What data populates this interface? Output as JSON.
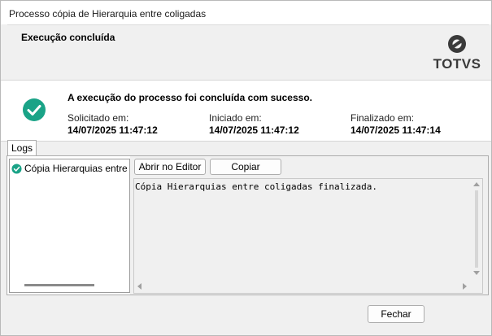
{
  "window": {
    "title": "Processo cópia de Hierarquia entre coligadas"
  },
  "header": {
    "title": "Execução concluída",
    "logo_text": "TOTVS"
  },
  "info": {
    "message": "A execução do processo foi concluída com sucesso.",
    "requested": {
      "label": "Solicitado em:",
      "value": "14/07/2025 11:47:12"
    },
    "started": {
      "label": "Iniciado em:",
      "value": "14/07/2025 11:47:12"
    },
    "finished": {
      "label": "Finalizado em:",
      "value": "14/07/2025 11:47:14"
    }
  },
  "tabs": [
    {
      "label": "Logs"
    }
  ],
  "logs": {
    "items": [
      {
        "label": "Cópia Hierarquias entre coligadas"
      }
    ]
  },
  "editor": {
    "open_button": "Abrir no Editor",
    "copy_button": "Copiar",
    "text": "Cópia Hierarquias entre coligadas finalizada."
  },
  "footer": {
    "close_button": "Fechar"
  },
  "colors": {
    "success": "#1aa387",
    "logo": "#3a3a3a"
  }
}
